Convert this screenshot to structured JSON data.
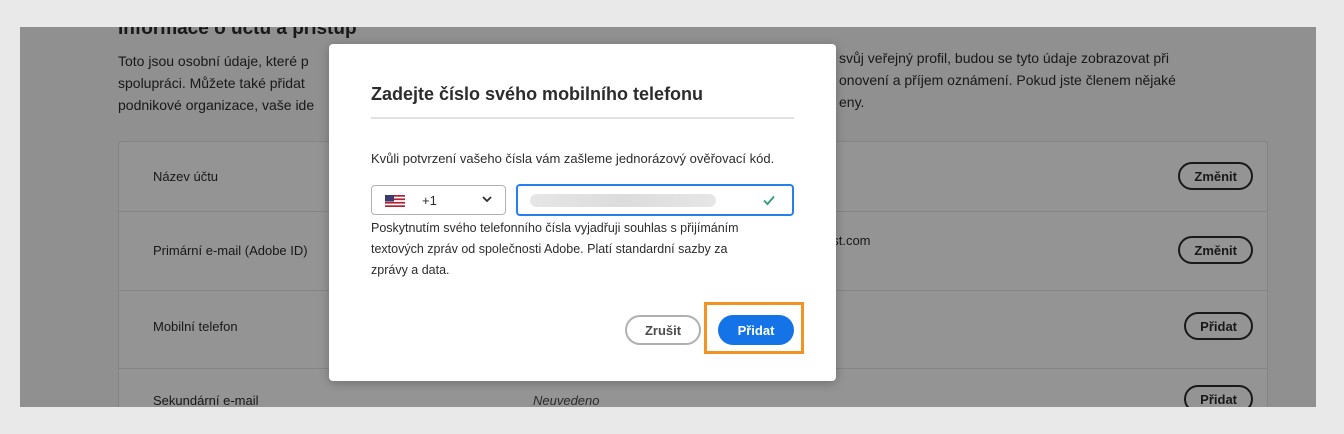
{
  "section": {
    "title": "Informace o účtu a přístup",
    "intro_lines": [
      "Toto jsou osobní údaje, které p",
      "spolupráci. Můžete také přidat",
      "podnikové organizace, vaše ide"
    ],
    "intro_right_lines": [
      "svůj veřejný profil, budou se tyto údaje zobrazovat při",
      "onovení a příjem oznámení. Pokud jste členem nějaké",
      "eny."
    ]
  },
  "rows": [
    {
      "label": "Název účtu",
      "value": "",
      "button": "Změnit"
    },
    {
      "label": "Primární e-mail (Adobe ID)",
      "value": "est.com",
      "button": "Změnit"
    },
    {
      "label": "Mobilní telefon",
      "value": "",
      "button": "Přidat"
    },
    {
      "label": "Sekundární e-mail",
      "value": "Neuvedeno",
      "button": "Přidat"
    }
  ],
  "modal": {
    "title": "Zadejte číslo svého mobilního telefonu",
    "description": "Kvůli potvrzení vašeho čísla vám zašleme jednorázový ověřovací kód.",
    "country": {
      "flag_icon": "us-flag-icon",
      "dial_code": "+1"
    },
    "phone_value": "",
    "consent_lines": [
      "Poskytnutím svého telefonního čísla vyjadřuji souhlas s přijímáním",
      "textových zpráv od společnosti Adobe. Platí standardní sazby za",
      "zprávy a data."
    ],
    "cancel_label": "Zrušit",
    "add_label": "Přidat"
  },
  "colors": {
    "accent": "#1473e6",
    "input_focus": "#2680eb",
    "highlight": "#f29423",
    "valid_check": "#2d9d78"
  }
}
